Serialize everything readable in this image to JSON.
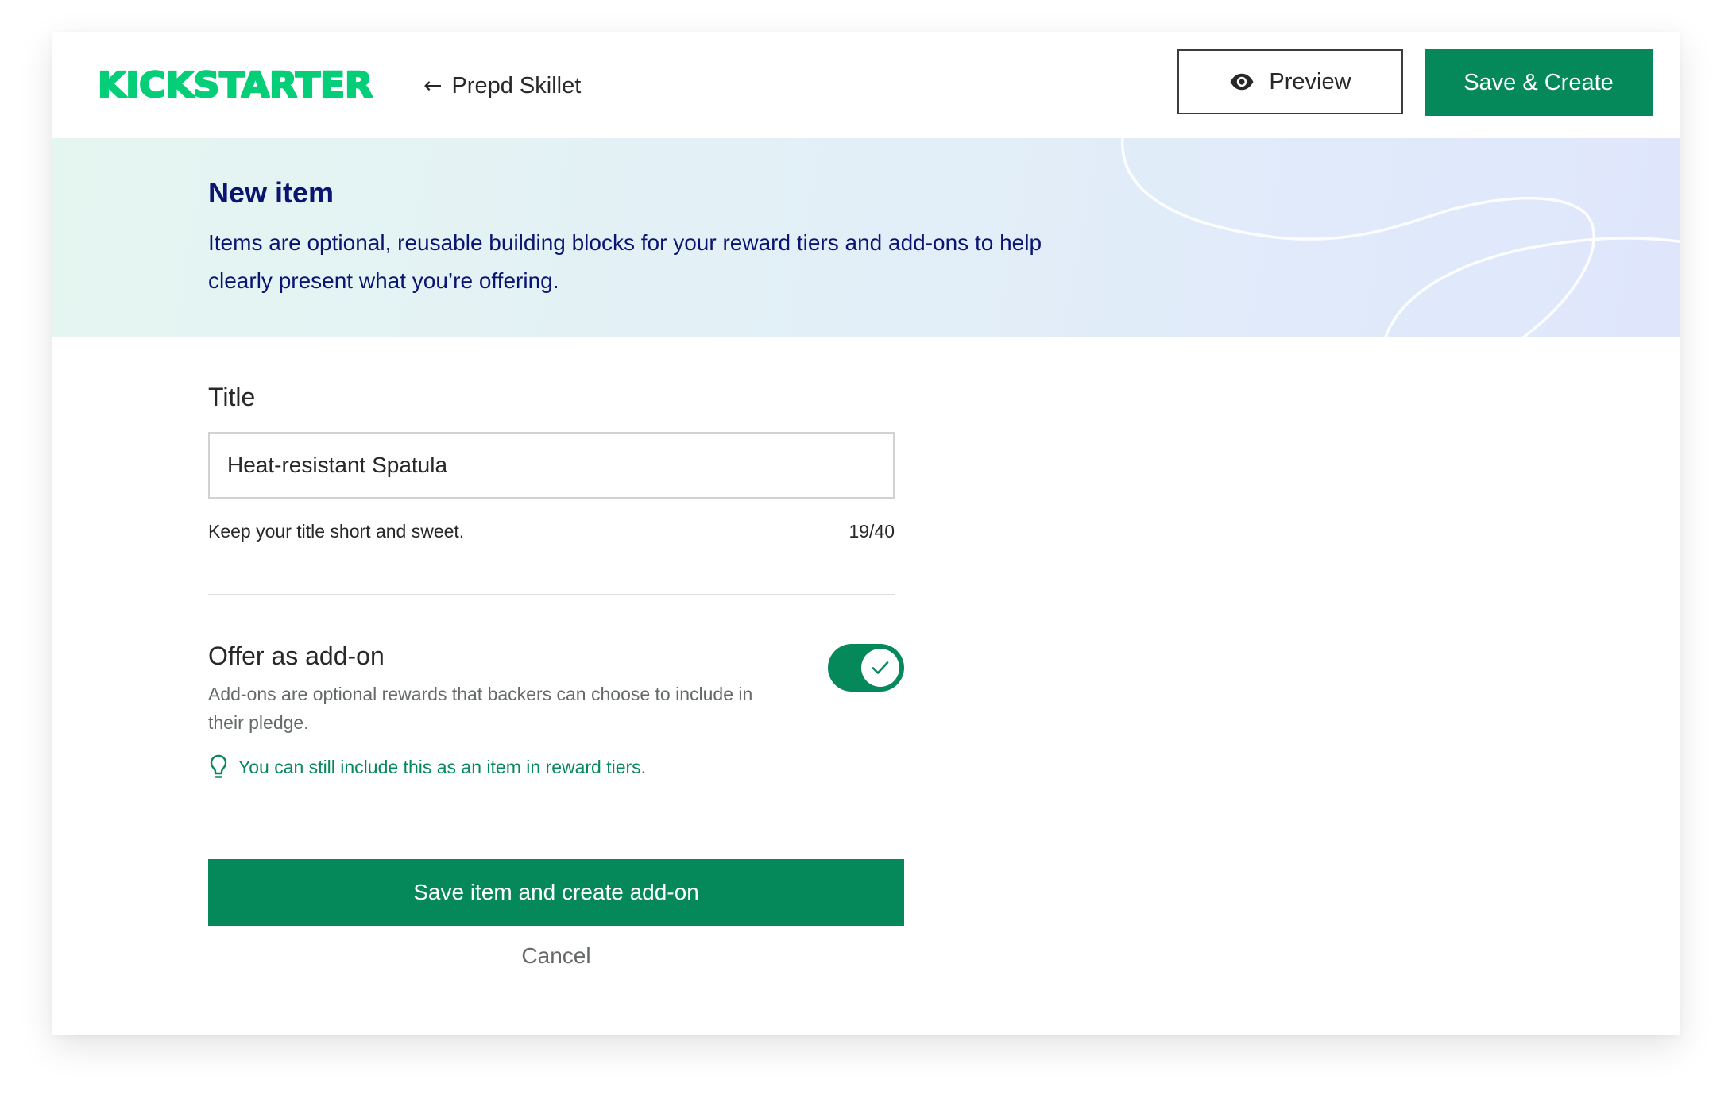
{
  "header": {
    "logo_text": "KICKSTARTER",
    "back_label": "Prepd Skillet",
    "preview_label": "Preview",
    "save_create_label": "Save & Create"
  },
  "banner": {
    "title": "New item",
    "description": "Items are optional, reusable building blocks for your reward tiers and add-ons to help clearly present what you’re offering."
  },
  "form": {
    "title_label": "Title",
    "title_value": "Heat-resistant Spatula",
    "title_helper": "Keep your title short and sweet.",
    "title_count": "19/40",
    "addon_label": "Offer as add-on",
    "addon_enabled": true,
    "addon_description": "Add-ons are optional rewards that backers can choose to include in their pledge.",
    "addon_tip": "You can still include this as an item in reward tiers.",
    "primary_button_label": "Save item and create add-on",
    "cancel_label": "Cancel"
  },
  "icons": {
    "back": "arrow-left-icon",
    "preview": "eye-icon",
    "toggle": "check-icon",
    "tip": "lightbulb-icon"
  },
  "colors": {
    "brand_green": "#05885a",
    "logo_green": "#05ce78",
    "heading_navy": "#0a1471",
    "text_dark": "#282828",
    "text_muted": "#656969"
  }
}
